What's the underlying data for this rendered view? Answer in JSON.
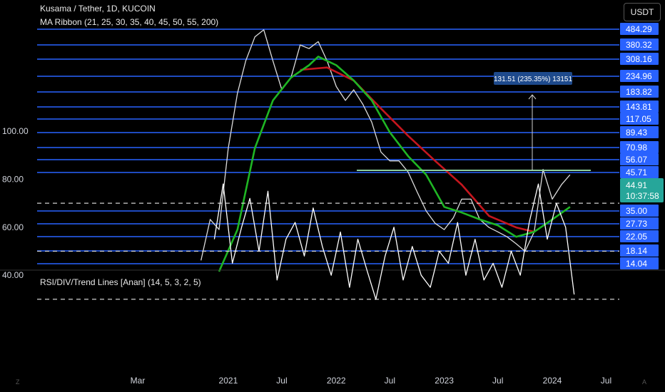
{
  "header": {
    "title": "Kusama / Tether, 1D, KUCOIN",
    "indicator": "MA Ribbon (21, 25, 30, 35, 40, 45, 50, 55, 200)",
    "currency": "USDT"
  },
  "measure": {
    "label": "131.51 (235.35%) 13151"
  },
  "current_price": {
    "price": "44.91",
    "countdown": "10:37:58"
  },
  "corners": {
    "left": "Z",
    "right": "A"
  },
  "chart_data": [
    {
      "type": "line",
      "x_ticks": [
        "Mar",
        "2021",
        "Jul",
        "2022",
        "Jul",
        "2023",
        "Jul",
        "2024",
        "Jul"
      ],
      "y_scale": "log",
      "y_ticks": [
        "484.29",
        "380.32",
        "308.16",
        "234.96",
        "183.82",
        "143.81",
        "117.05",
        "89.43",
        "70.98",
        "56.07",
        "45.71",
        "35.00",
        "27.73",
        "22.05",
        "18.14",
        "14.04"
      ],
      "horizontal_levels": [
        484.29,
        380.32,
        308.16,
        234.96,
        183.82,
        143.81,
        117.05,
        89.43,
        70.98,
        56.07,
        45.71,
        35.0,
        27.73,
        22.05,
        18.14,
        14.04
      ],
      "series": [
        {
          "x": [
            "2020-10-01",
            "2020-11-01",
            "2020-12-01",
            "2021-01-01",
            "2021-02-01",
            "2021-03-01",
            "2021-04-01",
            "2021-05-01",
            "2021-06-01",
            "2021-07-01",
            "2021-08-01",
            "2021-09-01",
            "2021-10-01",
            "2021-11-01",
            "2021-12-01",
            "2022-01-01",
            "2022-02-01",
            "2022-03-01",
            "2022-04-01",
            "2022-05-01",
            "2022-06-01",
            "2022-07-01",
            "2022-08-01",
            "2022-09-01",
            "2022-10-01",
            "2022-11-01",
            "2022-12-01",
            "2023-01-01",
            "2023-02-01",
            "2023-03-01",
            "2023-04-01",
            "2023-05-01",
            "2023-06-01",
            "2023-07-01",
            "2023-08-01",
            "2023-09-01",
            "2023-10-01",
            "2023-11-01",
            "2023-12-01",
            "2024-01-01",
            "2024-02-01",
            "2024-03-01"
          ],
          "values": [
            15,
            30,
            25,
            70,
            180,
            300,
            430,
            480,
            300,
            190,
            230,
            380,
            360,
            400,
            300,
            200,
            160,
            190,
            150,
            110,
            65,
            55,
            55,
            46,
            40,
            35,
            28,
            25,
            31,
            38,
            38,
            30,
            26,
            24,
            22,
            20,
            18,
            24,
            48,
            38,
            42,
            45
          ]
        },
        {
          "x": [
            "2021-09-01",
            "2021-12-01",
            "2022-03-01",
            "2022-06-01",
            "2022-09-01",
            "2022-12-01",
            "2023-03-01",
            "2023-06-01",
            "2023-09-01",
            "2023-11-01"
          ],
          "values": [
            260,
            270,
            220,
            140,
            85,
            55,
            42,
            32,
            26,
            24
          ]
        },
        {
          "x": [
            "2020-12-01",
            "2021-02-01",
            "2021-04-01",
            "2021-06-01",
            "2021-08-01",
            "2021-10-01",
            "2021-11-01",
            "2022-01-01",
            "2022-03-01",
            "2022-05-01",
            "2022-07-01",
            "2022-09-01",
            "2022-11-01",
            "2023-01-01",
            "2023-03-01",
            "2023-05-01",
            "2023-07-01",
            "2023-09-01",
            "2023-11-01",
            "2024-01-01",
            "2024-03-01"
          ],
          "values": [
            12,
            25,
            70,
            160,
            230,
            280,
            320,
            280,
            220,
            160,
            90,
            60,
            45,
            36,
            34,
            30,
            27,
            22,
            24,
            30,
            36
          ]
        }
      ]
    },
    {
      "type": "line",
      "title": "RSI/DIV/Trend Lines [Anan] (14, 5, 3, 2, 5)",
      "y_ticks": [
        "100.00",
        "80.00",
        "60.00",
        "40.00"
      ],
      "bands": [
        70,
        50,
        30
      ],
      "series": [
        {
          "x": [
            "2020-11-15",
            "2020-12-15",
            "2021-01-15",
            "2021-02-15",
            "2021-03-15",
            "2021-04-15",
            "2021-05-15",
            "2021-06-15",
            "2021-07-15",
            "2021-08-15",
            "2021-09-15",
            "2021-10-15",
            "2021-11-15",
            "2021-12-15",
            "2022-01-15",
            "2022-02-15",
            "2022-03-15",
            "2022-04-15",
            "2022-05-15",
            "2022-06-15",
            "2022-07-15",
            "2022-08-15",
            "2022-09-15",
            "2022-10-15",
            "2022-11-15",
            "2022-12-15",
            "2023-01-15",
            "2023-02-15",
            "2023-03-15",
            "2023-04-15",
            "2023-05-15",
            "2023-06-15",
            "2023-07-15",
            "2023-08-15",
            "2023-09-15",
            "2023-10-15",
            "2023-11-15",
            "2023-12-15",
            "2024-01-15",
            "2024-02-15",
            "2024-03-15"
          ],
          "values": [
            55,
            78,
            45,
            60,
            72,
            50,
            75,
            38,
            55,
            62,
            48,
            68,
            52,
            40,
            58,
            35,
            55,
            42,
            30,
            48,
            60,
            38,
            52,
            40,
            35,
            50,
            45,
            62,
            40,
            55,
            38,
            45,
            35,
            50,
            40,
            62,
            78,
            55,
            70,
            60,
            32
          ]
        }
      ]
    }
  ]
}
